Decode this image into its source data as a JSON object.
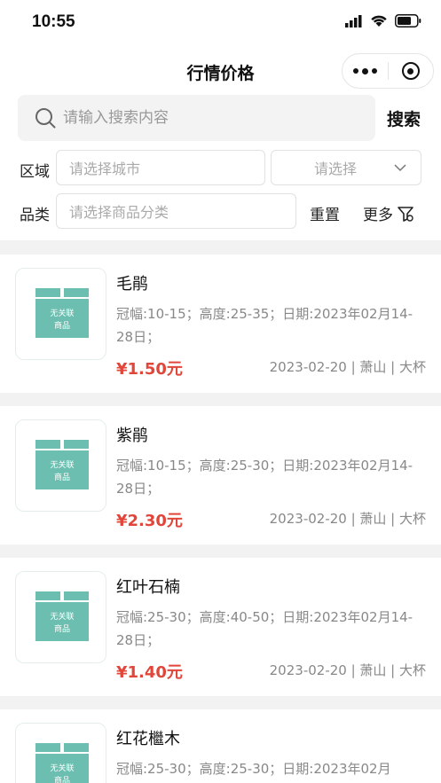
{
  "status": {
    "time": "10:55"
  },
  "nav": {
    "title": "行情价格"
  },
  "search": {
    "placeholder": "请输入搜索内容",
    "button": "搜索"
  },
  "filters": {
    "region_label": "区域",
    "city_placeholder": "请选择城市",
    "select_placeholder": "请选择",
    "category_label": "品类",
    "category_placeholder": "请选择商品分类",
    "reset": "重置",
    "more": "更多"
  },
  "colors": {
    "price": "#e0463a",
    "thumb_box": "#6cbfb0",
    "band": "#f2f2f2"
  },
  "products": [
    {
      "thumb_text_1": "无关联",
      "thumb_text_2": "商品",
      "name": "毛鹃",
      "desc": "冠幅:10-15；高度:25-35；日期:2023年02月14-28日；",
      "price": "¥1.50元",
      "meta": "2023-02-20 | 萧山 | 大杯"
    },
    {
      "thumb_text_1": "无关联",
      "thumb_text_2": "商品",
      "name": "紫鹃",
      "desc": "冠幅:10-15；高度:25-30；日期:2023年02月14-28日；",
      "price": "¥2.30元",
      "meta": "2023-02-20 | 萧山 | 大杯"
    },
    {
      "thumb_text_1": "无关联",
      "thumb_text_2": "商品",
      "name": "红叶石楠",
      "desc": "冠幅:25-30；高度:40-50；日期:2023年02月14-28日；",
      "price": "¥1.40元",
      "meta": "2023-02-20 | 萧山 | 大杯"
    },
    {
      "thumb_text_1": "无关联",
      "thumb_text_2": "商品",
      "name": "红花檵木",
      "desc": "冠幅:25-30；高度:25-30；日期:2023年02月",
      "price": "",
      "meta": ""
    }
  ]
}
